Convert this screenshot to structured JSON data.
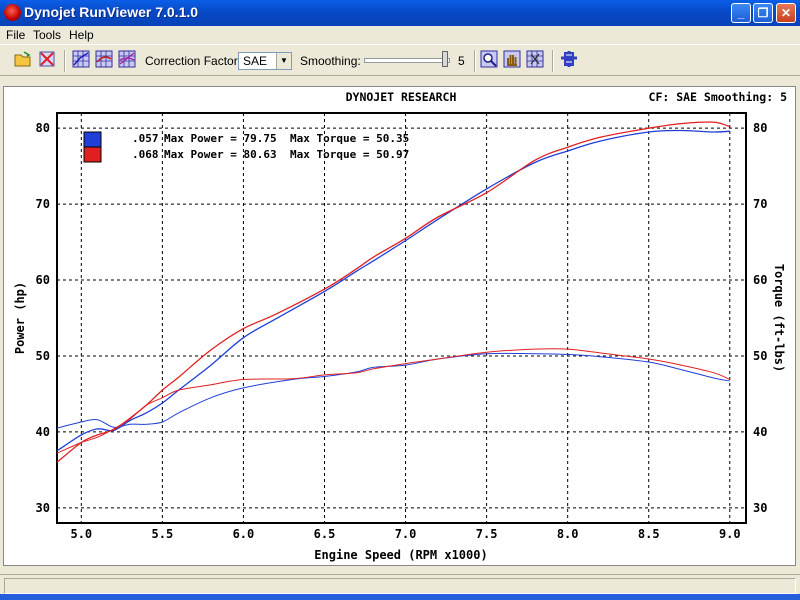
{
  "window": {
    "title": "Dynojet RunViewer 7.0.1.0"
  },
  "menu": [
    "File",
    "Tools",
    "Help"
  ],
  "toolbar": {
    "correction_label": "Correction Factor:",
    "correction_value": "SAE",
    "smoothing_label": "Smoothing:",
    "smoothing_value": "5",
    "smoothing_level": 5
  },
  "header": {
    "center": "DYNOJET RESEARCH",
    "right": "CF: SAE  Smoothing: 5"
  },
  "legend": [
    {
      "name": ".057",
      "max_power_label": "Max Power = 79.75",
      "max_torque_label": "Max Torque = 50.35"
    },
    {
      "name": ".068",
      "max_power_label": "Max Power = 80.63",
      "max_torque_label": "Max Torque = 50.97"
    }
  ],
  "colors": {
    "run1": "#1f3fd8",
    "run2": "#e02020",
    "chart_border": "#000000",
    "plot_bg": "#ffffff"
  },
  "chart_data": {
    "type": "line",
    "xlabel": "Engine Speed (RPM x1000)",
    "ylabel": "Power (hp)",
    "y2label": "Torque (ft-lbs)",
    "xlim": [
      4.85,
      9.1
    ],
    "ylim": [
      28,
      82
    ],
    "y2lim": [
      28,
      82
    ],
    "xticks": [
      "5.0",
      "5.5",
      "6.0",
      "6.5",
      "7.0",
      "7.5",
      "8.0",
      "8.5",
      "9.0"
    ],
    "yticks": [
      "30",
      "40",
      "50",
      "60",
      "70",
      "80"
    ],
    "y2ticks": [
      "30",
      "40",
      "50",
      "60",
      "70",
      "80"
    ],
    "grid": true,
    "series": [
      {
        "name": ".057",
        "kind": "power",
        "color": "#1f3fd8",
        "x": [
          4.85,
          5.0,
          5.1,
          5.2,
          5.3,
          5.4,
          5.5,
          5.6,
          5.8,
          6.0,
          6.2,
          6.5,
          6.7,
          6.8,
          7.0,
          7.2,
          7.5,
          7.8,
          8.0,
          8.2,
          8.5,
          8.7,
          8.9,
          9.0
        ],
        "y": [
          37.5,
          39.6,
          40.4,
          40.2,
          41.5,
          42.5,
          43.8,
          45.5,
          48.8,
          52.4,
          54.9,
          58.5,
          61.2,
          62.5,
          65.2,
          68.0,
          72.0,
          75.5,
          77.0,
          78.3,
          79.5,
          79.7,
          79.5,
          79.6
        ]
      },
      {
        "name": ".057",
        "kind": "torque",
        "color": "#1f3fd8",
        "x": [
          4.85,
          5.0,
          5.1,
          5.2,
          5.3,
          5.4,
          5.5,
          5.6,
          5.8,
          6.0,
          6.3,
          6.5,
          6.7,
          6.8,
          7.0,
          7.2,
          7.5,
          7.8,
          8.0,
          8.2,
          8.5,
          8.7,
          8.9,
          9.0
        ],
        "y": [
          40.5,
          41.3,
          41.6,
          40.6,
          41.0,
          41.0,
          41.3,
          42.5,
          44.5,
          45.8,
          46.9,
          47.3,
          47.9,
          48.5,
          48.8,
          49.6,
          50.3,
          50.3,
          50.2,
          49.9,
          49.2,
          48.2,
          47.1,
          46.7
        ]
      },
      {
        "name": ".068",
        "kind": "power",
        "color": "#e02020",
        "x": [
          4.85,
          5.0,
          5.1,
          5.2,
          5.3,
          5.4,
          5.5,
          5.6,
          5.8,
          6.0,
          6.2,
          6.5,
          6.7,
          6.8,
          7.0,
          7.2,
          7.5,
          7.8,
          8.0,
          8.2,
          8.5,
          8.7,
          8.9,
          9.0
        ],
        "y": [
          36.0,
          38.6,
          39.6,
          40.3,
          41.8,
          43.5,
          45.5,
          47.2,
          50.8,
          53.6,
          55.5,
          58.8,
          61.5,
          63.0,
          65.5,
          68.3,
          71.5,
          75.8,
          77.5,
          78.8,
          80.0,
          80.6,
          80.8,
          80.2
        ]
      },
      {
        "name": ".068",
        "kind": "torque",
        "color": "#e02020",
        "x": [
          4.85,
          5.0,
          5.1,
          5.2,
          5.3,
          5.4,
          5.5,
          5.6,
          5.8,
          6.0,
          6.3,
          6.5,
          6.7,
          6.8,
          7.0,
          7.2,
          7.5,
          7.8,
          8.0,
          8.2,
          8.5,
          8.7,
          8.9,
          9.0
        ],
        "y": [
          37.2,
          38.6,
          39.3,
          40.4,
          41.7,
          43.5,
          44.5,
          45.5,
          46.2,
          46.9,
          47.0,
          47.5,
          47.8,
          48.3,
          49.0,
          49.6,
          50.5,
          50.9,
          50.9,
          50.4,
          49.6,
          48.8,
          47.8,
          46.9
        ]
      }
    ]
  }
}
